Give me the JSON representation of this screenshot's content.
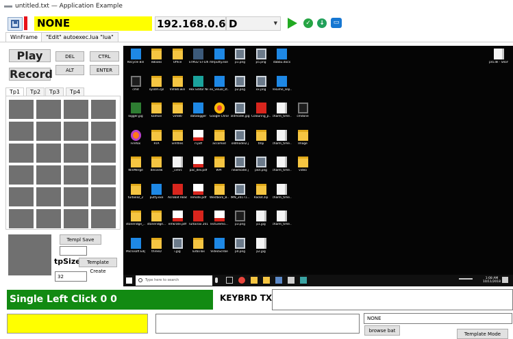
{
  "window": {
    "title": "untitled.txt — Application Example"
  },
  "toolbar": {
    "mode_value": "NONE",
    "ip_address": "192.168.0.6",
    "drive": "D",
    "icons": [
      "save-icon",
      "red-flag-icon",
      "play-icon",
      "check-icon",
      "download-icon",
      "folder-icon"
    ],
    "colors": {
      "mode_bg": "#ffff00",
      "play": "#22aa22",
      "flag": "#e8111a"
    }
  },
  "tabs": [
    {
      "label": "WinFrame"
    },
    {
      "label": "\"Edit\" autoexec.lua \"lua\""
    }
  ],
  "controls": {
    "play_label": "Play",
    "record_label": "Record",
    "del_label": "DEL",
    "ctrl_label": "CTRL",
    "alt_label": "ALT",
    "enter_label": "ENTER"
  },
  "tp_tabs": [
    {
      "label": "Tp1"
    },
    {
      "label": "Tp2"
    },
    {
      "label": "Tp3"
    },
    {
      "label": "Tp4"
    }
  ],
  "template": {
    "save_label": "Templ Save",
    "tpsize_label": "tpSize",
    "create_label": "Template Create",
    "size_value": "32"
  },
  "desktop": {
    "icons": [
      {
        "label": "Recycle Bin",
        "kind": "g-blue"
      },
      {
        "label": "eBooks",
        "kind": "g-folder"
      },
      {
        "label": "Office",
        "kind": "g-folder"
      },
      {
        "label": "STM32 ST-LIN...",
        "kind": "g-wait"
      },
      {
        "label": "mRputty.exe - Shortcut",
        "kind": "g-blue"
      },
      {
        "label": "p1.png",
        "kind": "g-img"
      },
      {
        "label": "p5.png",
        "kind": "g-img"
      },
      {
        "label": "dabbu.docx",
        "kind": "g-blue"
      },
      {
        "label": "cmd",
        "kind": "g-dark"
      },
      {
        "label": "sysdm.cpl",
        "kind": "g-folder"
      },
      {
        "label": "Vim80.win",
        "kind": "g-folder"
      },
      {
        "label": "Hex Editor Neo",
        "kind": "g-teal"
      },
      {
        "label": "ev_visual_st...",
        "kind": "g-blue"
      },
      {
        "label": "p2.png",
        "kind": "g-img"
      },
      {
        "label": "xx.png",
        "kind": "g-img"
      },
      {
        "label": "resume_sep...",
        "kind": "g-blue"
      },
      {
        "label": "logger.jpg",
        "kind": "g-green"
      },
      {
        "label": "kalman",
        "kind": "g-folder"
      },
      {
        "label": "vim80",
        "kind": "g-folder"
      },
      {
        "label": "datalogger",
        "kind": "g-blue"
      },
      {
        "label": "Google Chrome",
        "kind": "g-chrome"
      },
      {
        "label": "oldmodel.jpg",
        "kind": "g-img"
      },
      {
        "label": "Colouring_p...",
        "kind": "g-red"
      },
      {
        "label": "charm_time...",
        "kind": "g-doc"
      },
      {
        "label": "cmdone",
        "kind": "g-dark"
      },
      {
        "label": "Firefox",
        "kind": "g-ff"
      },
      {
        "label": "RTA",
        "kind": "g-folder"
      },
      {
        "label": "vimfiles",
        "kind": "g-folder"
      },
      {
        "label": "rl.pdf",
        "kind": "g-pdf"
      },
      {
        "label": "accomod",
        "kind": "g-folder"
      },
      {
        "label": "oldmodel2.j",
        "kind": "g-img"
      },
      {
        "label": "tmp",
        "kind": "g-folder"
      },
      {
        "label": "charm_time...",
        "kind": "g-doc"
      },
      {
        "label": "Image",
        "kind": "g-folder"
      },
      {
        "label": "WinMerge",
        "kind": "g-folder"
      },
      {
        "label": "devview",
        "kind": "g-folder"
      },
      {
        "label": "_vimrc",
        "kind": "g-doc"
      },
      {
        "label": "pac_dev.pdf",
        "kind": "g-pdf"
      },
      {
        "label": "WPF",
        "kind": "g-folder"
      },
      {
        "label": "newmodel.j",
        "kind": "g-img"
      },
      {
        "label": "plot.png",
        "kind": "g-img"
      },
      {
        "label": "charm_time...",
        "kind": "g-doc"
      },
      {
        "label": "video",
        "kind": "g-folder"
      },
      {
        "label": "turbolaz_2",
        "kind": "g-folder"
      },
      {
        "label": "putty.exe",
        "kind": "g-blue"
      },
      {
        "label": "Acrobat Reader DC",
        "kind": "g-red"
      },
      {
        "label": "remote.pdf",
        "kind": "g-pdf"
      },
      {
        "label": "Westboro_B...",
        "kind": "g-folder"
      },
      {
        "label": "IMN_20171...",
        "kind": "g-img"
      },
      {
        "label": "Rack4.zip",
        "kind": "g-folder"
      },
      {
        "label": "charm_time...",
        "kind": "g-doc"
      },
      {
        "label": "stoneridge_...",
        "kind": "g-folder"
      },
      {
        "label": "stoneridge...",
        "kind": "g-folder"
      },
      {
        "label": "emkrate.pdf",
        "kind": "g-pdf"
      },
      {
        "label": "TurboTax 2016",
        "kind": "g-red"
      },
      {
        "label": "lecturemo...",
        "kind": "g-pdf"
      },
      {
        "label": "p3.png",
        "kind": "g-dark"
      },
      {
        "label": "p1.jpg",
        "kind": "g-doc"
      },
      {
        "label": "charm_time...",
        "kind": "g-doc"
      },
      {
        "label": "Microsoft Edge",
        "kind": "g-blue"
      },
      {
        "label": "threeD",
        "kind": "g-folder"
      },
      {
        "label": "i.jpg",
        "kind": "g-img"
      },
      {
        "label": "TurboTax",
        "kind": "g-folder"
      },
      {
        "label": "VideoScribe",
        "kind": "g-blue"
      },
      {
        "label": "p4.png",
        "kind": "g-img"
      },
      {
        "label": "p2.jpg",
        "kind": "g-doc"
      }
    ],
    "right_icon": {
      "label": "pro.dll - Shortcut"
    },
    "taskbar": {
      "search_placeholder": "Type here to search",
      "time": "1:08 AM",
      "date": "10/11/2018"
    }
  },
  "bottom": {
    "status_text": "Single Left Click 0 0",
    "keybrd_label": "KEYBRD TXT",
    "none_value": "NONE",
    "browse_label": "browse bat",
    "template_mode_label": "Template Mode",
    "colors": {
      "status_bg": "#128a12",
      "input_bg": "#ffff00"
    }
  }
}
